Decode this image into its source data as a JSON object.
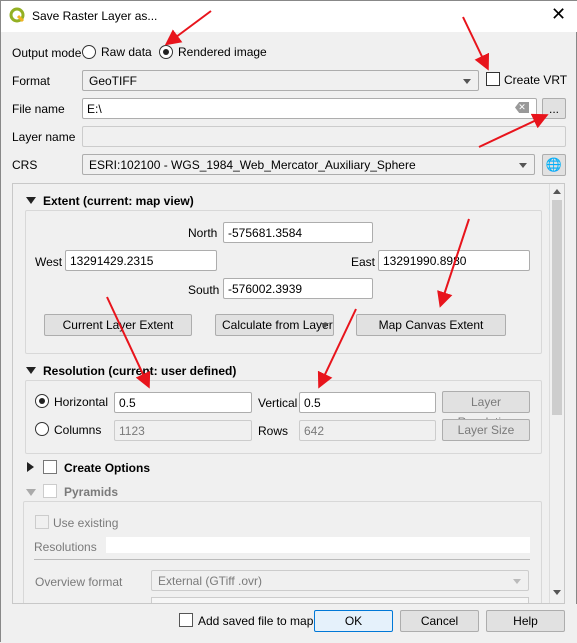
{
  "window": {
    "title": "Save Raster Layer as...",
    "close_icon": "close-icon"
  },
  "output_mode": {
    "label": "Output mode",
    "options": [
      "Raw data",
      "Rendered image"
    ],
    "selected": "Rendered image"
  },
  "format": {
    "label": "Format",
    "value": "GeoTIFF",
    "create_vrt_label": "Create VRT",
    "create_vrt_checked": false
  },
  "file_name": {
    "label": "File name",
    "value": "E:\\",
    "browse_label": "..."
  },
  "layer_name": {
    "label": "Layer name",
    "value": ""
  },
  "crs": {
    "label": "CRS",
    "value": "ESRI:102100 - WGS_1984_Web_Mercator_Auxiliary_Sphere"
  },
  "extent": {
    "title": "Extent (current: map view)",
    "north_label": "North",
    "north": "-575681.3584",
    "west_label": "West",
    "west": "13291429.2315",
    "east_label": "East",
    "east": "13291990.8980",
    "south_label": "South",
    "south": "-576002.3939",
    "current_layer_extent": "Current Layer Extent",
    "calculate_from_layer": "Calculate from Layer",
    "map_canvas_extent": "Map Canvas Extent"
  },
  "resolution": {
    "title": "Resolution (current: user defined)",
    "horizontal_label": "Horizontal",
    "horizontal": "0.5",
    "vertical_label": "Vertical",
    "vertical": "0.5",
    "layer_resolution": "Layer Resolution",
    "columns_label": "Columns",
    "columns": "1123",
    "rows_label": "Rows",
    "rows": "642",
    "layer_size": "Layer Size",
    "selected": "Horizontal"
  },
  "create_options": {
    "title": "Create Options"
  },
  "pyramids": {
    "title": "Pyramids",
    "use_existing": "Use existing",
    "resolutions_label": "Resolutions",
    "resolutions": "",
    "overview_format_label": "Overview format",
    "overview_format": "External (GTiff .ovr)"
  },
  "footer": {
    "add_saved_file": "Add saved file to map",
    "ok": "OK",
    "cancel": "Cancel",
    "help": "Help"
  },
  "colors": {
    "annotation_arrow": "#e8141c",
    "qgis_logo": "#93b023"
  }
}
